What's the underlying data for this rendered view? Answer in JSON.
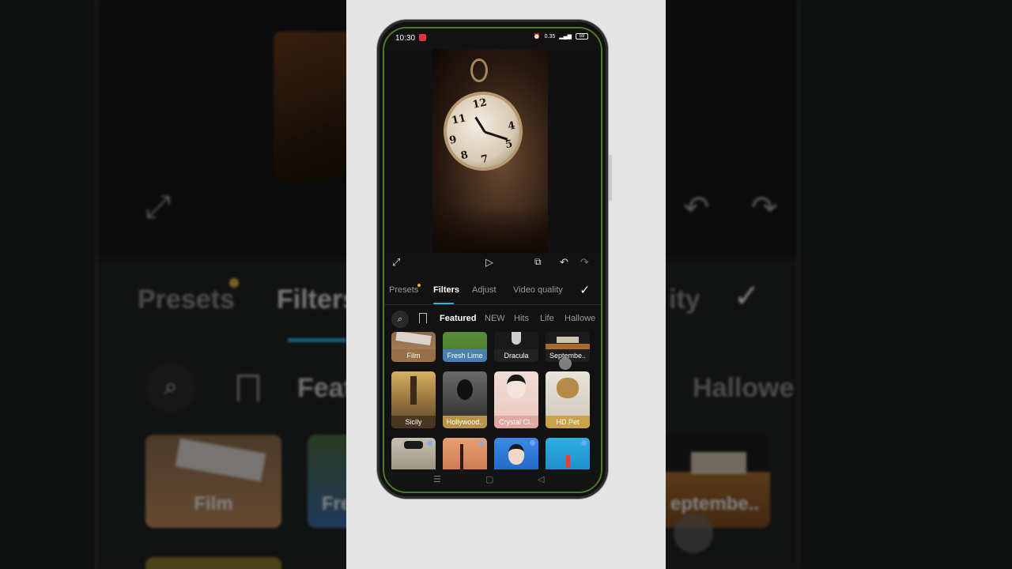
{
  "status": {
    "time": "10:30",
    "net_speed": "0.35",
    "battery": "59"
  },
  "tabs": [
    {
      "label": "Presets"
    },
    {
      "label": "Filters"
    },
    {
      "label": "Adjust"
    },
    {
      "label": "Video quality"
    }
  ],
  "categories": [
    "Featured",
    "NEW",
    "Hits",
    "Life",
    "Hallowe"
  ],
  "filters_row1": [
    "Film",
    "Fresh Lime",
    "Dracula",
    "Septembe.."
  ],
  "filters_row2": [
    "Sicily",
    "Hollywood..",
    "Crystal Cl..",
    "HD Pet"
  ],
  "background": {
    "presets": "Presets",
    "filters": "Filters",
    "feat": "Feat",
    "ity": "ity",
    "hallowe": "Hallowe",
    "film": "Film",
    "fre": "Fre",
    "septembe": "eptembe.."
  },
  "icons": {
    "expand": "expand-icon",
    "play": "play-icon",
    "undo": "undo-icon",
    "redo": "redo-icon",
    "confirm": "check-icon",
    "search": "search-icon",
    "bookmark": "bookmark-icon"
  },
  "colors": {
    "accent": "#2bb3e8",
    "badge": "#f1b233",
    "frame_green": "#4d7a2a"
  }
}
